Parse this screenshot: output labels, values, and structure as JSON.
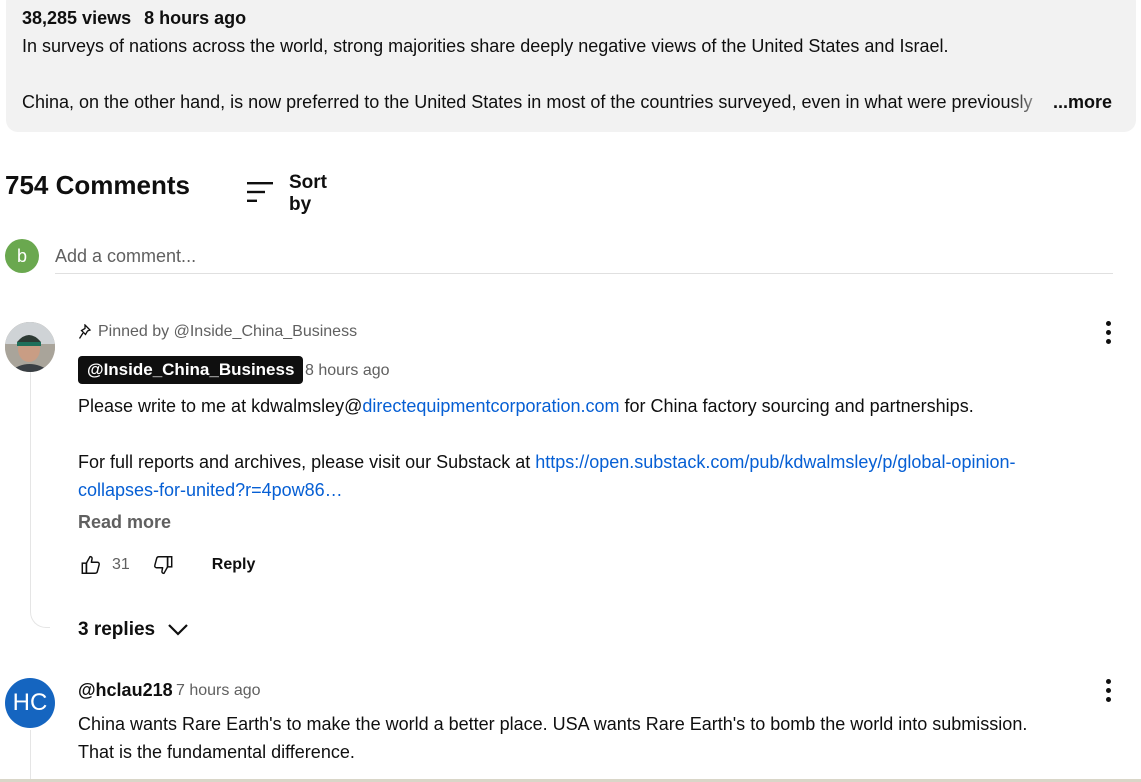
{
  "description": {
    "views": "38,285 views",
    "age": "8 hours ago",
    "line1": "In surveys of nations across the world, strong majorities share deeply negative views of the United States and Israel.",
    "line2": "China, on the other hand, is now preferred to the United States in most of the countries surveyed, even in what were previously",
    "more_label": "...more"
  },
  "comments_header": {
    "count_label": "754 Comments",
    "sort_label": "Sort by"
  },
  "composer": {
    "avatar_letter": "b",
    "placeholder": "Add a comment...",
    "avatar_color": "#6aa84f"
  },
  "pinned_comment": {
    "pinned_label": "Pinned by @Inside_China_Business",
    "author": "@Inside_China_Business",
    "time": "8 hours ago",
    "p1_before": "Please write to me at kdwalmsley@",
    "p1_link": "directequipmentcorporation.com",
    "p1_after": " for China factory sourcing and partnerships.",
    "p2_before": "For full reports and archives, please visit our Substack at ",
    "p2_link_line1": "https://open.substack.com/pub/kdwalmsley/p/global-opinion-",
    "p2_link_line2": "collapses-for-united?r=4pow86…",
    "read_more": "Read more",
    "likes": "31",
    "reply_label": "Reply",
    "replies_label": "3 replies"
  },
  "comment2": {
    "avatar_initials": "HC",
    "avatar_color": "#1565c0",
    "author": "@hclau218",
    "time": "7 hours ago",
    "line1": "China wants Rare Earth's to make the world a better place. USA wants Rare Earth's to bomb the world into submission.",
    "line2": "That is the fundamental difference."
  },
  "colors": {
    "link": "#065fd4",
    "secondary_text": "#606060",
    "description_bg": "#f2f2f2"
  }
}
